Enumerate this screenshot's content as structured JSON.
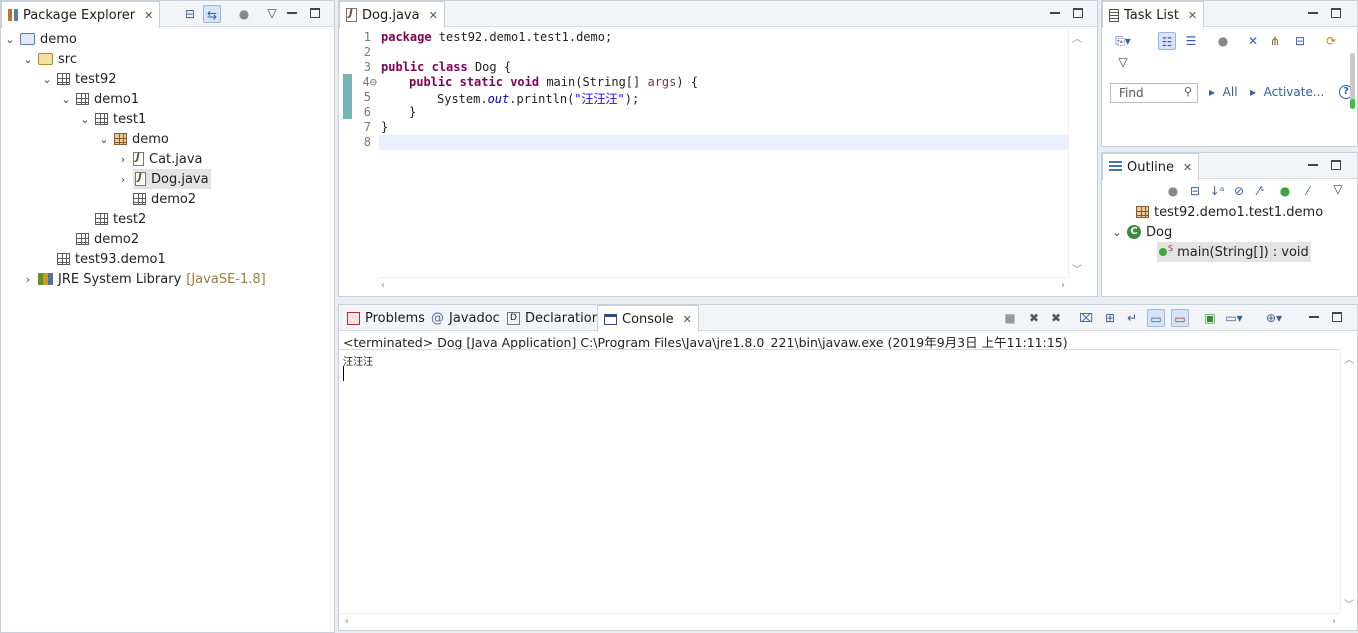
{
  "package_explorer": {
    "title": "Package Explorer",
    "tree": [
      {
        "label": "demo",
        "level": 0,
        "icon": "project-icon",
        "expanded": true
      },
      {
        "label": "src",
        "level": 1,
        "icon": "source-folder-icon",
        "expanded": true
      },
      {
        "label": "test92",
        "level": 2,
        "icon": "package-icon",
        "expanded": true
      },
      {
        "label": "demo1",
        "level": 3,
        "icon": "package-icon",
        "expanded": true
      },
      {
        "label": "test1",
        "level": 4,
        "icon": "package-icon",
        "expanded": true
      },
      {
        "label": "demo",
        "level": 5,
        "icon": "package-icon",
        "expanded": true
      },
      {
        "label": "Cat.java",
        "level": 6,
        "icon": "java-file-icon",
        "expanded": false
      },
      {
        "label": "Dog.java",
        "level": 6,
        "icon": "java-file-icon",
        "expanded": false,
        "selected": true
      },
      {
        "label": "demo2",
        "level": 5,
        "icon": "package-icon"
      },
      {
        "label": "test2",
        "level": 4,
        "icon": "package-icon"
      },
      {
        "label": "demo2",
        "level": 3,
        "icon": "package-icon"
      },
      {
        "label": "test93.demo1",
        "level": 2,
        "icon": "package-icon"
      },
      {
        "label": "JRE System Library",
        "suffix": "[JavaSE-1.8]",
        "level": 1,
        "icon": "library-icon",
        "expanded": false
      }
    ]
  },
  "editor": {
    "tab": "Dog.java",
    "line_numbers": [
      "1",
      "2",
      "3",
      "4⊖",
      "5",
      "6",
      "7",
      "8"
    ],
    "lines": {
      "l1_kw": "package",
      "l1_rest": " test92.demo1.test1.demo;",
      "l3_kw1": "public",
      "l3_kw2": "class",
      "l3_rest": " Dog {",
      "l4_kw1": "public",
      "l4_kw2": "static",
      "l4_kw3": "void",
      "l4_mid": " main(String[] ",
      "l4_arg": "args",
      "l4_end": ") {",
      "l5_a": "System.",
      "l5_static": "out",
      "l5_b": ".println(",
      "l5_str": "\"汪汪汪\"",
      "l5_c": ");",
      "l6": "}",
      "l7": "}"
    }
  },
  "task_list": {
    "title": "Task List",
    "find_placeholder": "Find",
    "all_label": "All",
    "activate_label": "Activate...",
    "help": "?"
  },
  "outline": {
    "title": "Outline",
    "package": "test92.demo1.test1.demo",
    "class": "Dog",
    "method": "main(String[]) : void",
    "method_modifier": "S"
  },
  "bottom": {
    "tabs": [
      "Problems",
      "Javadoc",
      "Declaration",
      "Console"
    ],
    "active_tab": "Console",
    "status": "<terminated> Dog [Java Application] C:\\Program Files\\Java\\jre1.8.0_221\\bin\\javaw.exe (2019年9月3日 上午11:11:15)",
    "output": "汪汪汪"
  }
}
